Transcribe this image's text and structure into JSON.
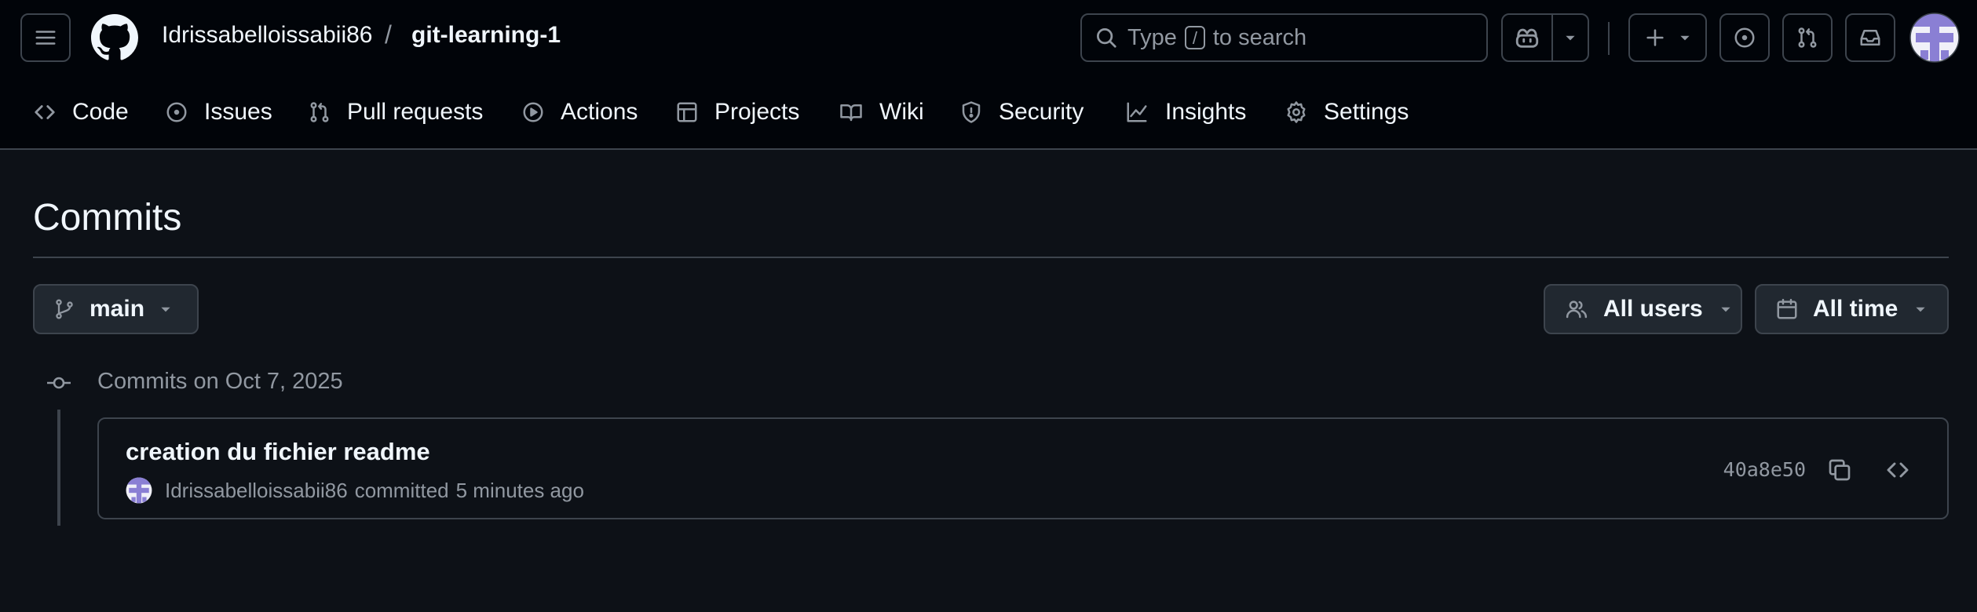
{
  "header": {
    "owner": "Idrissabelloissabii86",
    "separator": "/",
    "repo": "git-learning-1",
    "search": {
      "prefix": "Type",
      "key": "/",
      "suffix": "to search"
    }
  },
  "repo_nav": {
    "tabs": [
      {
        "label": "Code",
        "icon": "code-icon"
      },
      {
        "label": "Issues",
        "icon": "issue-opened-icon"
      },
      {
        "label": "Pull requests",
        "icon": "git-pull-request-icon"
      },
      {
        "label": "Actions",
        "icon": "play-icon"
      },
      {
        "label": "Projects",
        "icon": "table-icon"
      },
      {
        "label": "Wiki",
        "icon": "book-icon"
      },
      {
        "label": "Security",
        "icon": "shield-icon"
      },
      {
        "label": "Insights",
        "icon": "graph-icon"
      },
      {
        "label": "Settings",
        "icon": "gear-icon"
      }
    ]
  },
  "page": {
    "title": "Commits",
    "branch": "main",
    "users_filter": "All users",
    "time_filter": "All time"
  },
  "commit_groups": [
    {
      "label": "Commits on Oct 7, 2025",
      "commits": [
        {
          "message": "creation du fichier readme",
          "author": "Idrissabelloissabii86",
          "action": "committed",
          "time": "5 minutes ago",
          "sha": "40a8e50"
        }
      ]
    }
  ],
  "colors": {
    "header_bg": "#010409",
    "page_bg": "#0d1117",
    "border": "#3d444d",
    "text": "#f0f6fc",
    "muted": "#9198a1",
    "button_bg": "#212830",
    "avatar_accent": "#8a7fd4"
  }
}
